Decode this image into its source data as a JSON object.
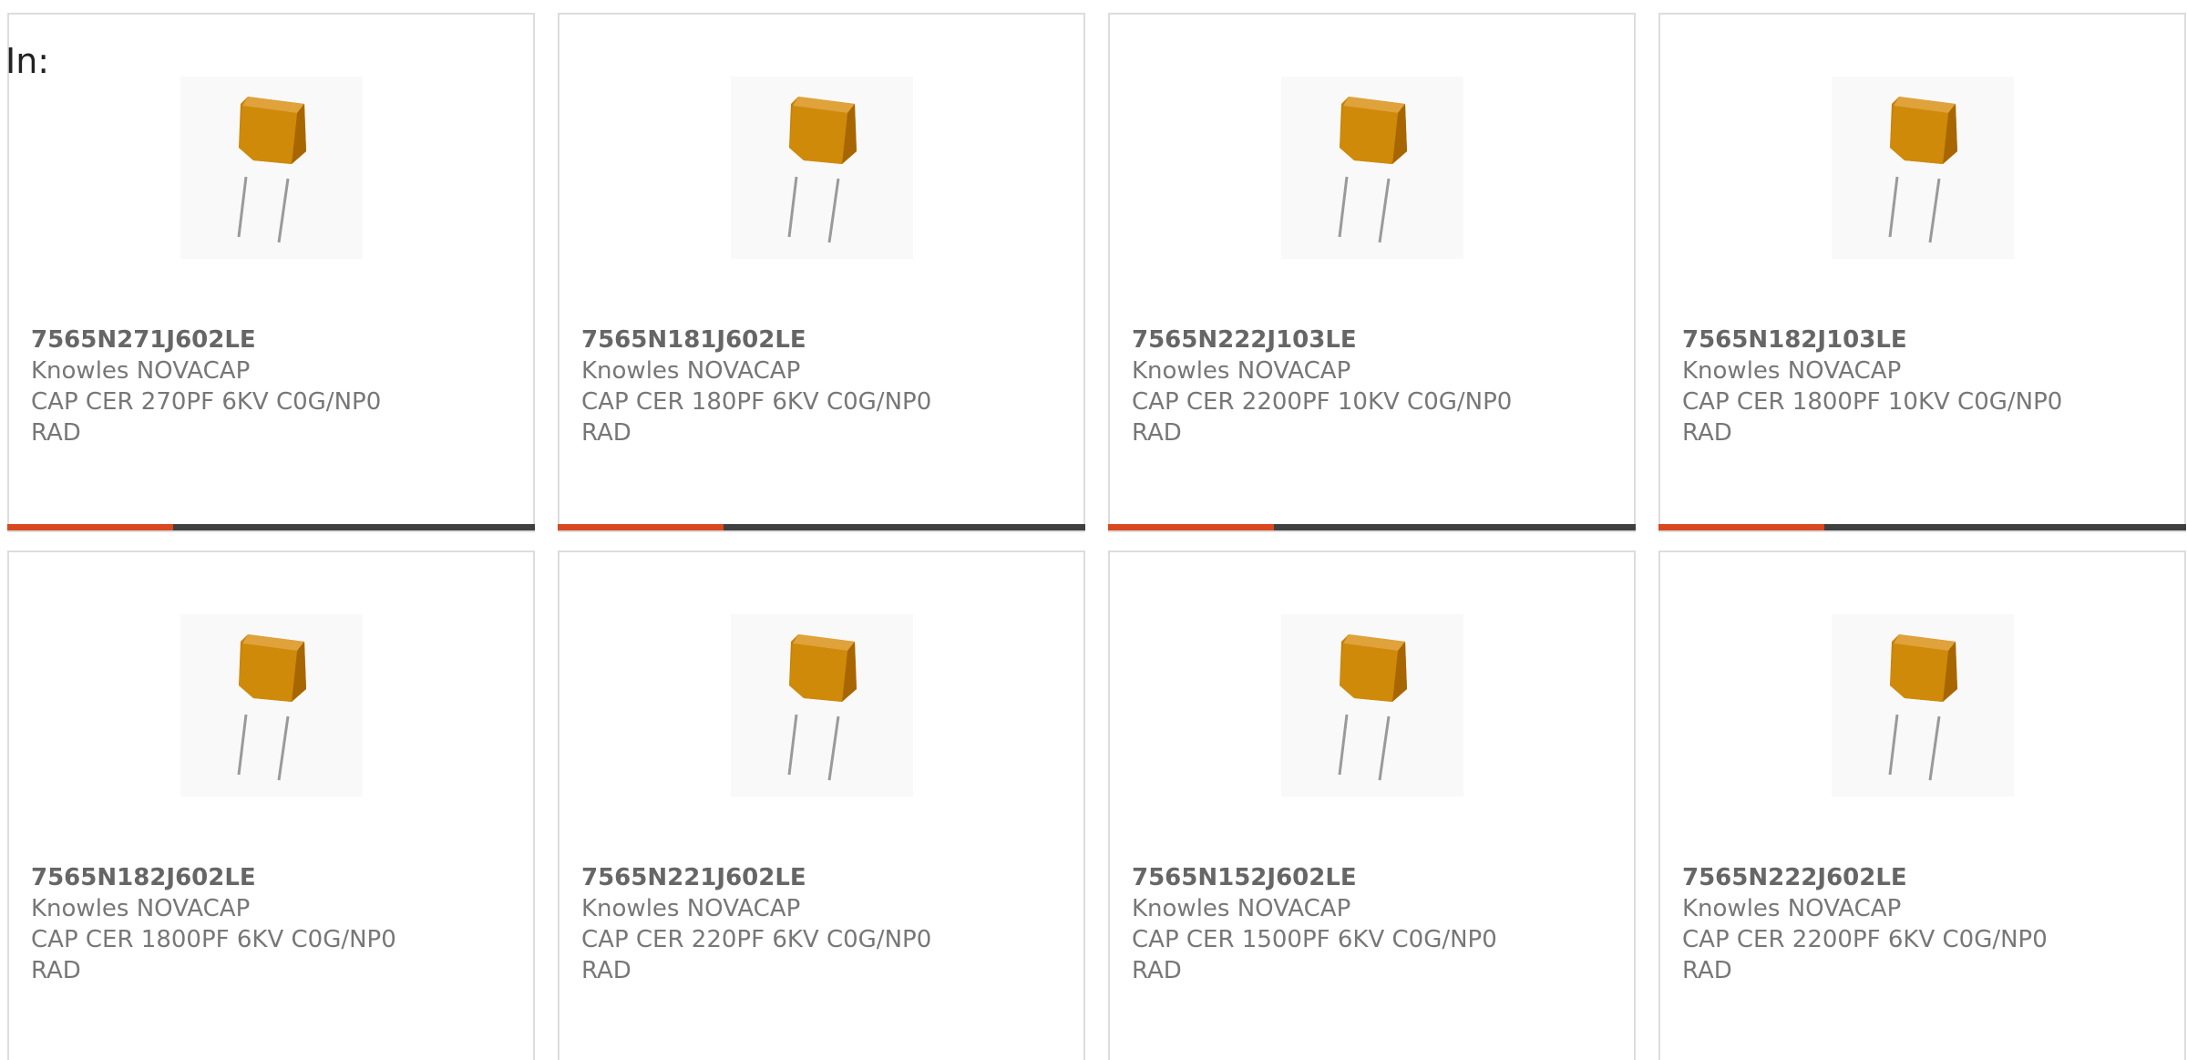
{
  "filter": {
    "label": "In:"
  },
  "accent_color": "#d9481f",
  "track_color": "#404040",
  "products": [
    {
      "part_number": "7565N271J602LE",
      "manufacturer": "Knowles NOVACAP",
      "description": "CAP CER 270PF 6KV C0G/NP0",
      "package": "RAD",
      "image_icon": "radial-ceramic-capacitor-icon",
      "progress": 0.315
    },
    {
      "part_number": "7565N181J602LE",
      "manufacturer": "Knowles NOVACAP",
      "description": "CAP CER 180PF 6KV C0G/NP0",
      "package": "RAD",
      "image_icon": "radial-ceramic-capacitor-icon",
      "progress": 0.315
    },
    {
      "part_number": "7565N222J103LE",
      "manufacturer": "Knowles NOVACAP",
      "description": "CAP CER 2200PF 10KV C0G/NP0",
      "package": "RAD",
      "image_icon": "radial-ceramic-capacitor-icon",
      "progress": 0.315
    },
    {
      "part_number": "7565N182J103LE",
      "manufacturer": "Knowles NOVACAP",
      "description": "CAP CER 1800PF 10KV C0G/NP0",
      "package": "RAD",
      "image_icon": "radial-ceramic-capacitor-icon",
      "progress": 0.315
    },
    {
      "part_number": "7565N182J602LE",
      "manufacturer": "Knowles NOVACAP",
      "description": "CAP CER 1800PF 6KV C0G/NP0",
      "package": "RAD",
      "image_icon": "radial-ceramic-capacitor-icon"
    },
    {
      "part_number": "7565N221J602LE",
      "manufacturer": "Knowles NOVACAP",
      "description": "CAP CER 220PF 6KV C0G/NP0",
      "package": "RAD",
      "image_icon": "radial-ceramic-capacitor-icon"
    },
    {
      "part_number": "7565N152J602LE",
      "manufacturer": "Knowles NOVACAP",
      "description": "CAP CER 1500PF 6KV C0G/NP0",
      "package": "RAD",
      "image_icon": "radial-ceramic-capacitor-icon"
    },
    {
      "part_number": "7565N222J602LE",
      "manufacturer": "Knowles NOVACAP",
      "description": "CAP CER 2200PF 6KV C0G/NP0",
      "package": "RAD",
      "image_icon": "radial-ceramic-capacitor-icon"
    }
  ]
}
